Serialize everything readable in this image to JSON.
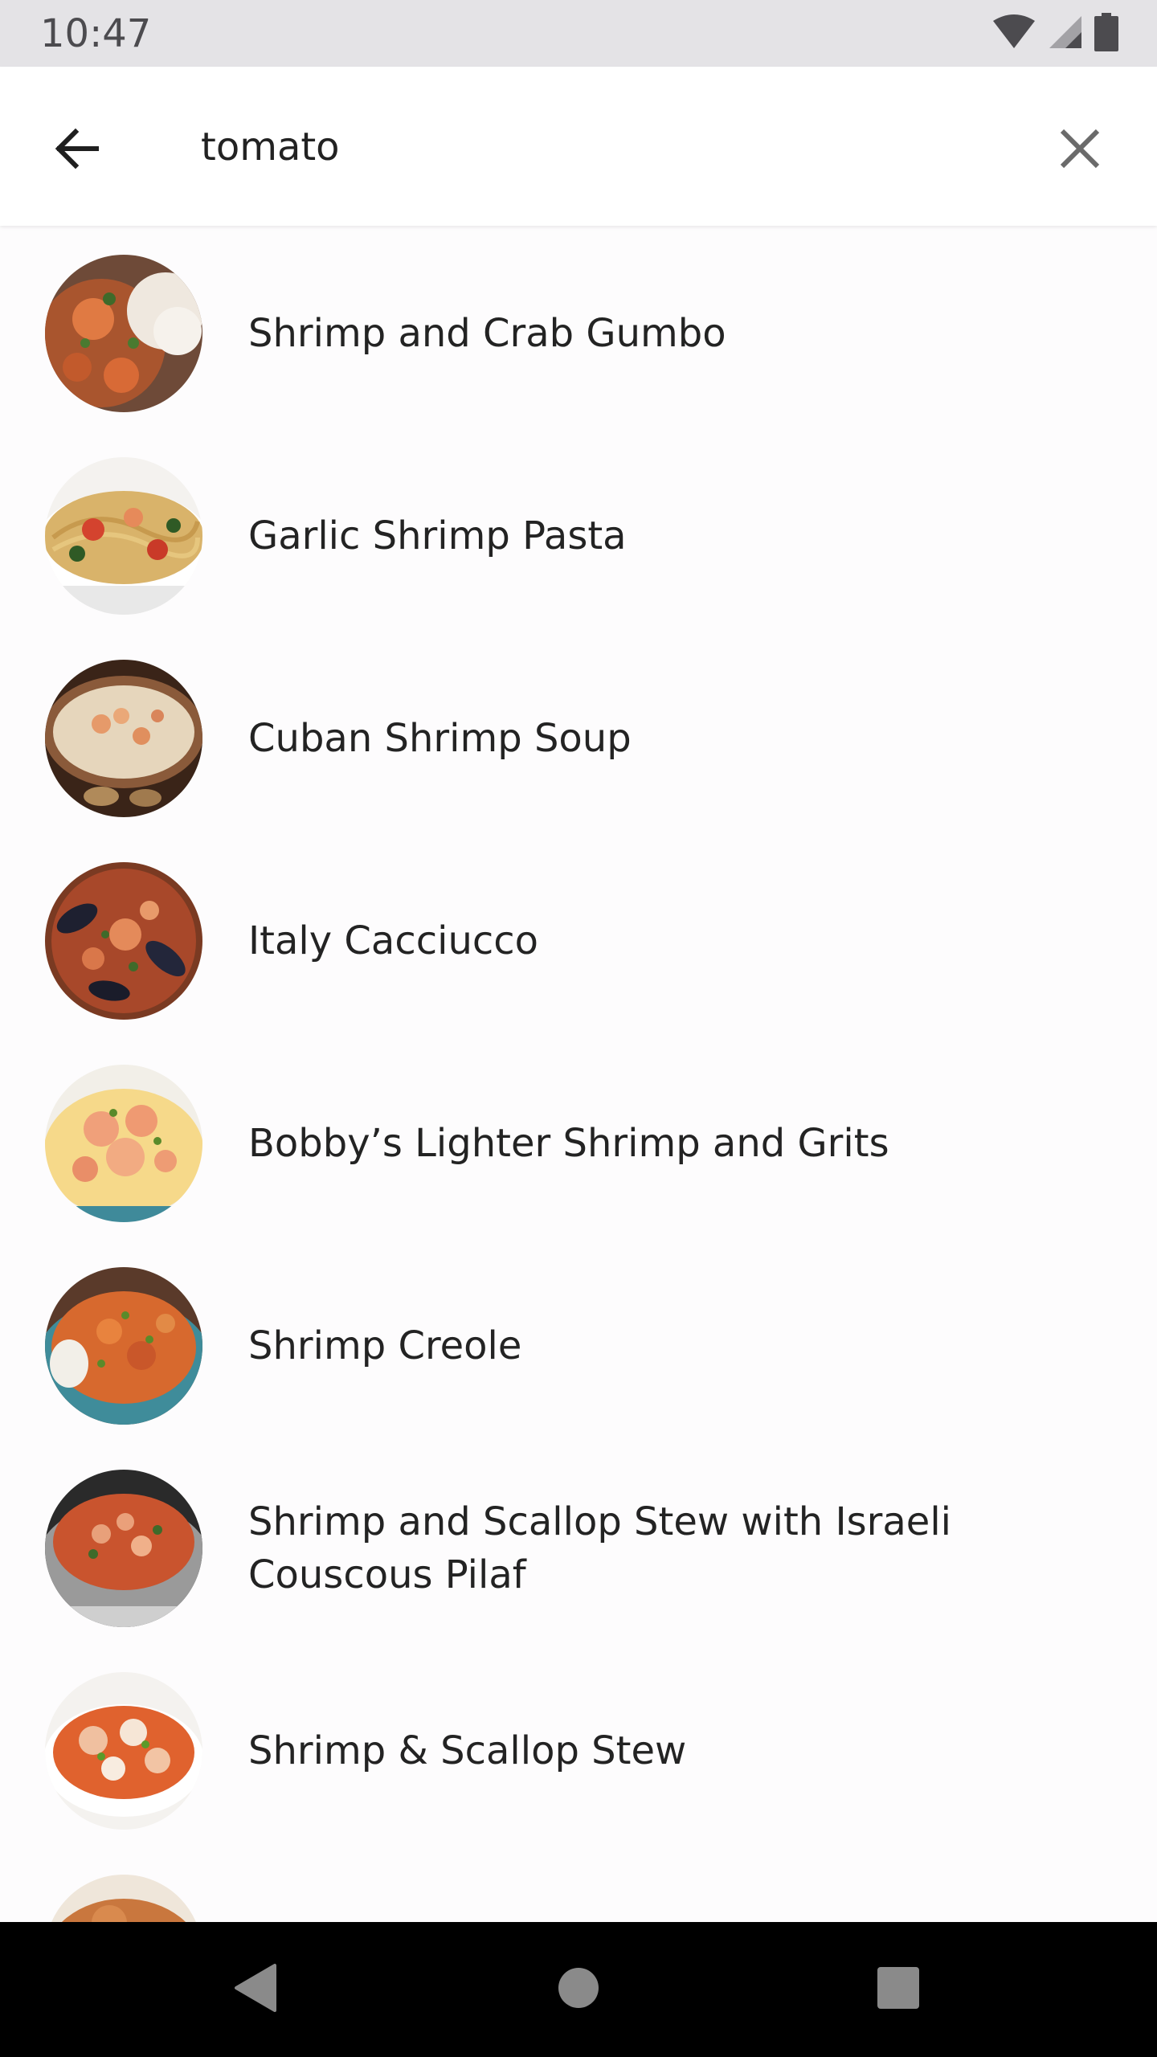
{
  "status_bar": {
    "time": "10:47",
    "icons": [
      "wifi-icon",
      "cellular-signal-icon",
      "battery-icon"
    ]
  },
  "search_bar": {
    "back_icon": "arrow-back-icon",
    "query": "tomato",
    "clear_icon": "close-icon"
  },
  "results": [
    {
      "title": "Shrimp and Crab Gumbo",
      "thumbnail": "gumbo-photo"
    },
    {
      "title": "Garlic Shrimp Pasta",
      "thumbnail": "pasta-photo"
    },
    {
      "title": "Cuban Shrimp Soup",
      "thumbnail": "soup-photo"
    },
    {
      "title": "Italy Cacciucco",
      "thumbnail": "cacciucco-photo"
    },
    {
      "title": "Bobby’s Lighter Shrimp and Grits",
      "thumbnail": "grits-photo"
    },
    {
      "title": "Shrimp Creole",
      "thumbnail": "creole-photo"
    },
    {
      "title": "Shrimp and Scallop Stew with Israeli Couscous Pilaf",
      "thumbnail": "stew-pot-photo"
    },
    {
      "title": "Shrimp & Scallop Stew",
      "thumbnail": "scallop-stew-photo"
    },
    {
      "title": "",
      "thumbnail": "partial-photo"
    }
  ],
  "nav_bar": {
    "back": "nav-back-icon",
    "home": "nav-home-icon",
    "recents": "nav-recents-icon"
  },
  "colors": {
    "status_bar_bg": "#e4e3e6",
    "app_bar_bg": "#ffffff",
    "list_bg": "#fdfcfd",
    "text": "#232323",
    "icon": "#222222",
    "nav_bar_bg": "#000000"
  }
}
